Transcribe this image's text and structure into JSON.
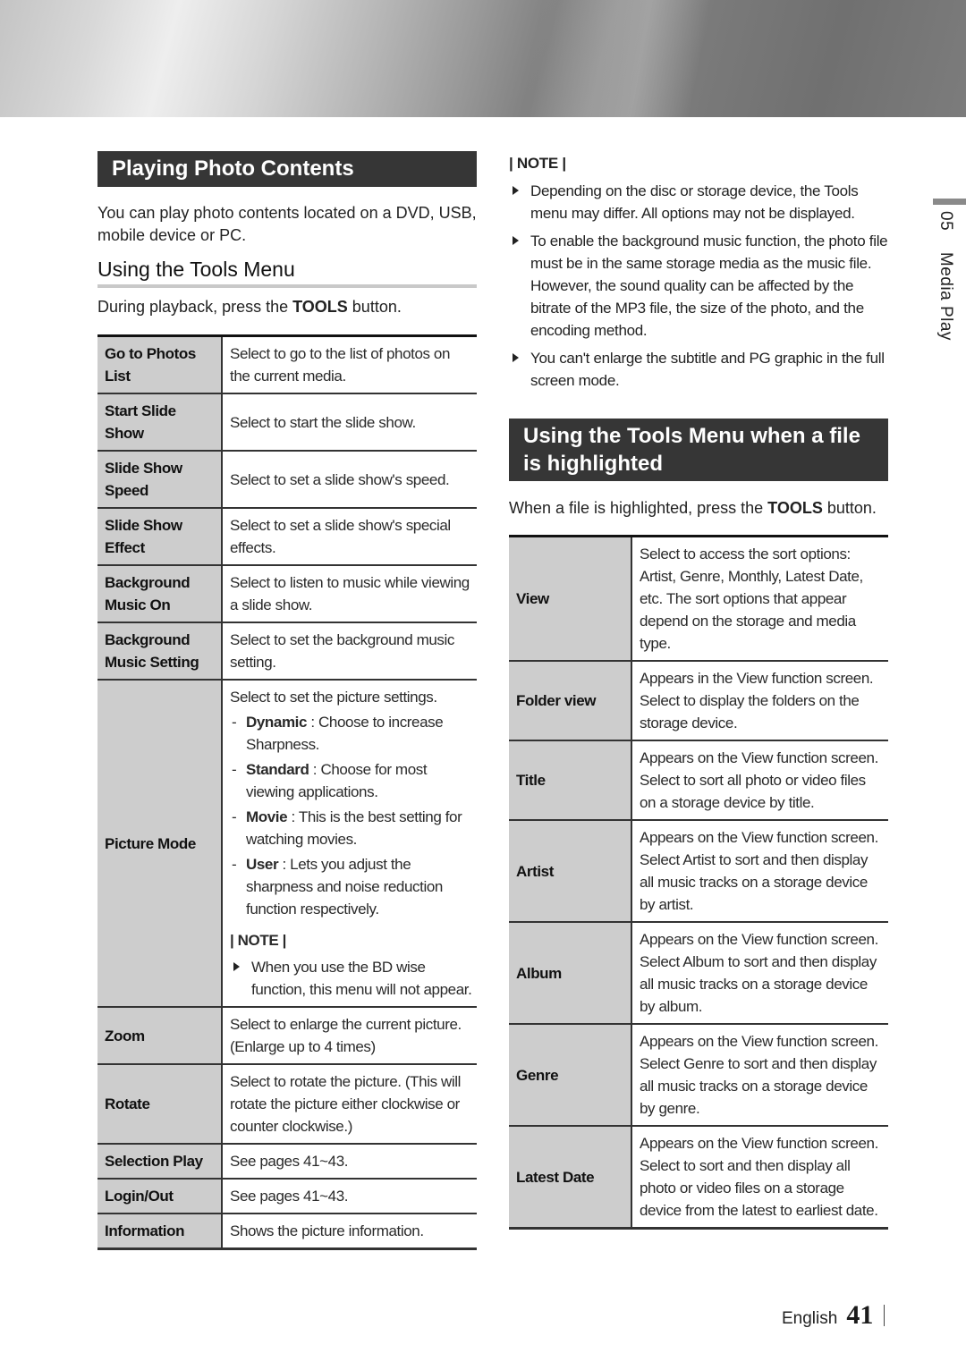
{
  "left": {
    "section_title": "Playing Photo Contents",
    "intro": "You can play photo contents located on a DVD, USB, mobile device or PC.",
    "subhead": "Using the Tools Menu",
    "instruction_pre": "During playback, press the ",
    "instruction_key": "TOOLS",
    "instruction_post": " button.",
    "rows": [
      {
        "key": "Go to Photos List",
        "val": "Select to go to the list of photos on the current media."
      },
      {
        "key": "Start Slide Show",
        "val": "Select to start the slide show."
      },
      {
        "key": "Slide Show Speed",
        "val": "Select to set a slide show's speed."
      },
      {
        "key": "Slide Show Effect",
        "val": "Select to set a slide show's special effects."
      },
      {
        "key": "Background Music On",
        "val": "Select to listen to music while viewing a slide show."
      },
      {
        "key": "Background Music Setting",
        "val": "Select to set the background music setting."
      }
    ],
    "picture_mode": {
      "key": "Picture Mode",
      "intro": "Select to set the picture settings.",
      "options": [
        {
          "name": "Dynamic",
          "desc": " : Choose to increase Sharpness."
        },
        {
          "name": "Standard",
          "desc": " : Choose for most viewing applications."
        },
        {
          "name": "Movie",
          "desc": " : This is the best setting for watching movies."
        },
        {
          "name": "User",
          "desc": " : Lets you adjust the sharpness and noise reduction function respectively."
        }
      ],
      "dash": "-",
      "note_label": "| NOTE |",
      "note": "When you use the BD wise function, this menu will not appear."
    },
    "rows_after": [
      {
        "key": "Zoom",
        "val": "Select to enlarge the current picture. (Enlarge up to 4 times)"
      },
      {
        "key": "Rotate",
        "val": "Select to rotate the picture. (This will rotate the picture either clockwise or counter clockwise.)"
      },
      {
        "key": "Selection Play",
        "val": "See pages 41~43."
      },
      {
        "key": "Login/Out",
        "val": "See pages 41~43."
      },
      {
        "key": "Information",
        "val": "Shows the picture information."
      }
    ]
  },
  "right": {
    "note_label": "| NOTE |",
    "notes": [
      "Depending on the disc or storage device, the Tools menu may differ. All options may not be displayed.",
      "To enable the background music function, the photo file must be in the same storage media as the music file. However, the sound quality can be affected by the bitrate of the MP3 file, the size of the photo, and the encoding method.",
      "You can't enlarge the subtitle and PG graphic in the full screen mode."
    ],
    "section_title": "Using the Tools Menu when a file is highlighted",
    "instruction_pre": "When a file is highlighted, press the ",
    "instruction_key": "TOOLS",
    "instruction_post": " button.",
    "rows": [
      {
        "key": "View",
        "val": "Select to access the sort options: Artist, Genre, Monthly, Latest Date, etc. The sort options that appear depend on the storage and media type."
      },
      {
        "key": "Folder view",
        "val": "Appears in the View function screen. Select to display the folders on the storage device."
      },
      {
        "key": "Title",
        "val": "Appears on the View function screen. Select to sort all photo or video files on a storage device by title."
      },
      {
        "key": "Artist",
        "val": "Appears on the View function screen. Select Artist to sort and then display all music tracks on a storage device by artist."
      },
      {
        "key": "Album",
        "val": "Appears on the View function screen. Select Album to sort and then display all music tracks on a storage device by album."
      },
      {
        "key": "Genre",
        "val": "Appears on the View function screen. Select Genre to sort and then display all music tracks on a storage device by genre."
      },
      {
        "key": "Latest Date",
        "val": "Appears on the View function screen. Select to sort and then display all photo or video files on a storage device from the latest to earliest date."
      }
    ]
  },
  "side": {
    "chapter_num": "05",
    "chapter_title": "Media Play"
  },
  "footer": {
    "language": "English",
    "page": "41"
  }
}
